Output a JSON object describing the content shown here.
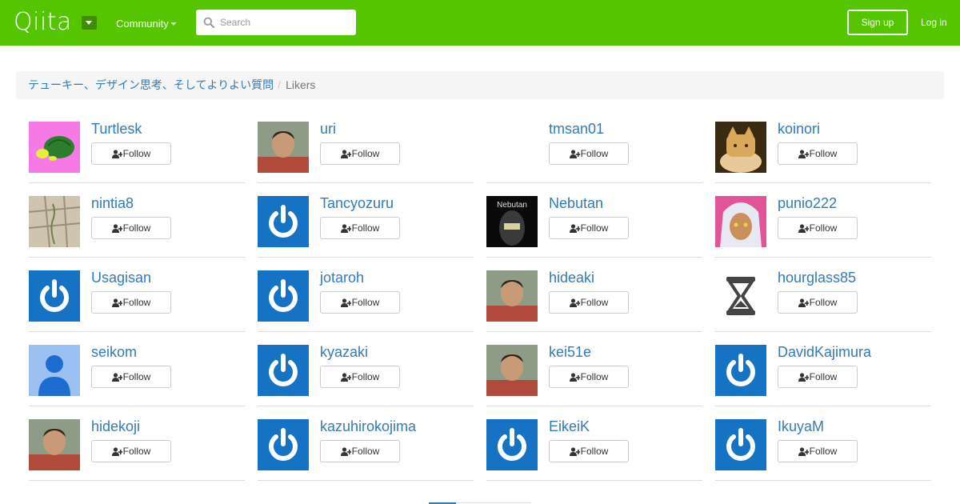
{
  "header": {
    "logo": "Qiita",
    "community_label": "Community",
    "search_placeholder": "Search",
    "signup_label": "Sign up",
    "login_label": "Log in"
  },
  "breadcrumb": {
    "article": "テューキー、デザイン思考、そしてよりよい質問",
    "separator": "/",
    "current": "Likers"
  },
  "follow_label": "Follow",
  "colors": {
    "brand": "#55c500",
    "link": "#337ab7",
    "default_avatar": "#1673c4"
  },
  "likers": [
    {
      "name": "Turtlesk",
      "avatar": "turtle-avatar"
    },
    {
      "name": "uri",
      "avatar": "photo-avatar"
    },
    {
      "name": "tmsan01",
      "avatar": "blank-avatar"
    },
    {
      "name": "koinori",
      "avatar": "cat-avatar"
    },
    {
      "name": "nintia8",
      "avatar": "pavement-avatar"
    },
    {
      "name": "Tancyozuru",
      "avatar": "default-avatar"
    },
    {
      "name": "Nebutan",
      "avatar": "nebutan-avatar"
    },
    {
      "name": "punio222",
      "avatar": "anime-avatar"
    },
    {
      "name": "Usagisan",
      "avatar": "default-avatar"
    },
    {
      "name": "jotaroh",
      "avatar": "default-avatar"
    },
    {
      "name": "hideaki",
      "avatar": "photo-avatar"
    },
    {
      "name": "hourglass85",
      "avatar": "hourglass-avatar"
    },
    {
      "name": "seikom",
      "avatar": "person-silhouette-avatar"
    },
    {
      "name": "kyazaki",
      "avatar": "default-avatar"
    },
    {
      "name": "kei51e",
      "avatar": "photo-avatar"
    },
    {
      "name": "DavidKajimura",
      "avatar": "default-avatar"
    },
    {
      "name": "hidekoji",
      "avatar": "photo-avatar"
    },
    {
      "name": "kazuhirokojima",
      "avatar": "default-avatar"
    },
    {
      "name": "EikeiK",
      "avatar": "default-avatar"
    },
    {
      "name": "IkuyaM",
      "avatar": "default-avatar"
    }
  ]
}
